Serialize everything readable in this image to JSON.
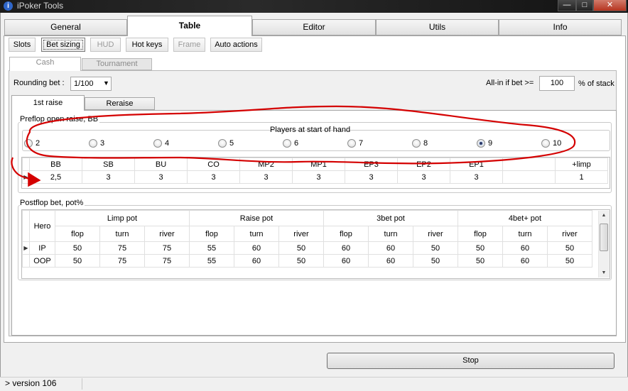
{
  "window": {
    "title": "iPoker Tools",
    "min": "—",
    "max": "□",
    "close": "✕"
  },
  "main_tabs": [
    "General",
    "Table",
    "Editor",
    "Utils",
    "Info"
  ],
  "sub_tabs": [
    "Slots",
    "Bet sizing",
    "HUD",
    "Hot keys",
    "Frame",
    "Auto actions"
  ],
  "mode_tabs": [
    "Cash",
    "Tournament"
  ],
  "settings": {
    "rounding_label": "Rounding bet :",
    "rounding_value": "1/100",
    "allin_label": "All-in if bet >=",
    "allin_value": "100",
    "allin_suffix": "% of stack"
  },
  "raise_tabs": [
    "1st raise",
    "Reraise"
  ],
  "preflop": {
    "title": "Preflop open raise, BB",
    "players_title": "Players at start of hand",
    "player_options": [
      "2",
      "3",
      "4",
      "5",
      "6",
      "7",
      "8",
      "9",
      "10"
    ],
    "selected": "9",
    "columns": [
      "BB",
      "SB",
      "BU",
      "CO",
      "MP2",
      "MP1",
      "EP3",
      "EP2",
      "EP1",
      "",
      "+limp"
    ],
    "values": [
      "2,5",
      "3",
      "3",
      "3",
      "3",
      "3",
      "3",
      "3",
      "3",
      "",
      "1"
    ]
  },
  "postflop": {
    "title": "Postflop bet, pot%",
    "row_header": "Hero",
    "groups": [
      "Limp pot",
      "Raise pot",
      "3bet pot",
      "4bet+ pot"
    ],
    "streets": [
      "flop",
      "turn",
      "river"
    ],
    "rows": [
      {
        "hero": "IP",
        "values": [
          "50",
          "75",
          "75",
          "55",
          "60",
          "50",
          "60",
          "60",
          "50",
          "50",
          "60",
          "50"
        ]
      },
      {
        "hero": "OOP",
        "values": [
          "50",
          "75",
          "75",
          "55",
          "60",
          "50",
          "60",
          "60",
          "50",
          "50",
          "60",
          "50"
        ]
      }
    ]
  },
  "stop_label": "Stop",
  "status": "> version 106",
  "colors": {
    "annotation": "#d40000",
    "accent": "#1a3a80"
  }
}
